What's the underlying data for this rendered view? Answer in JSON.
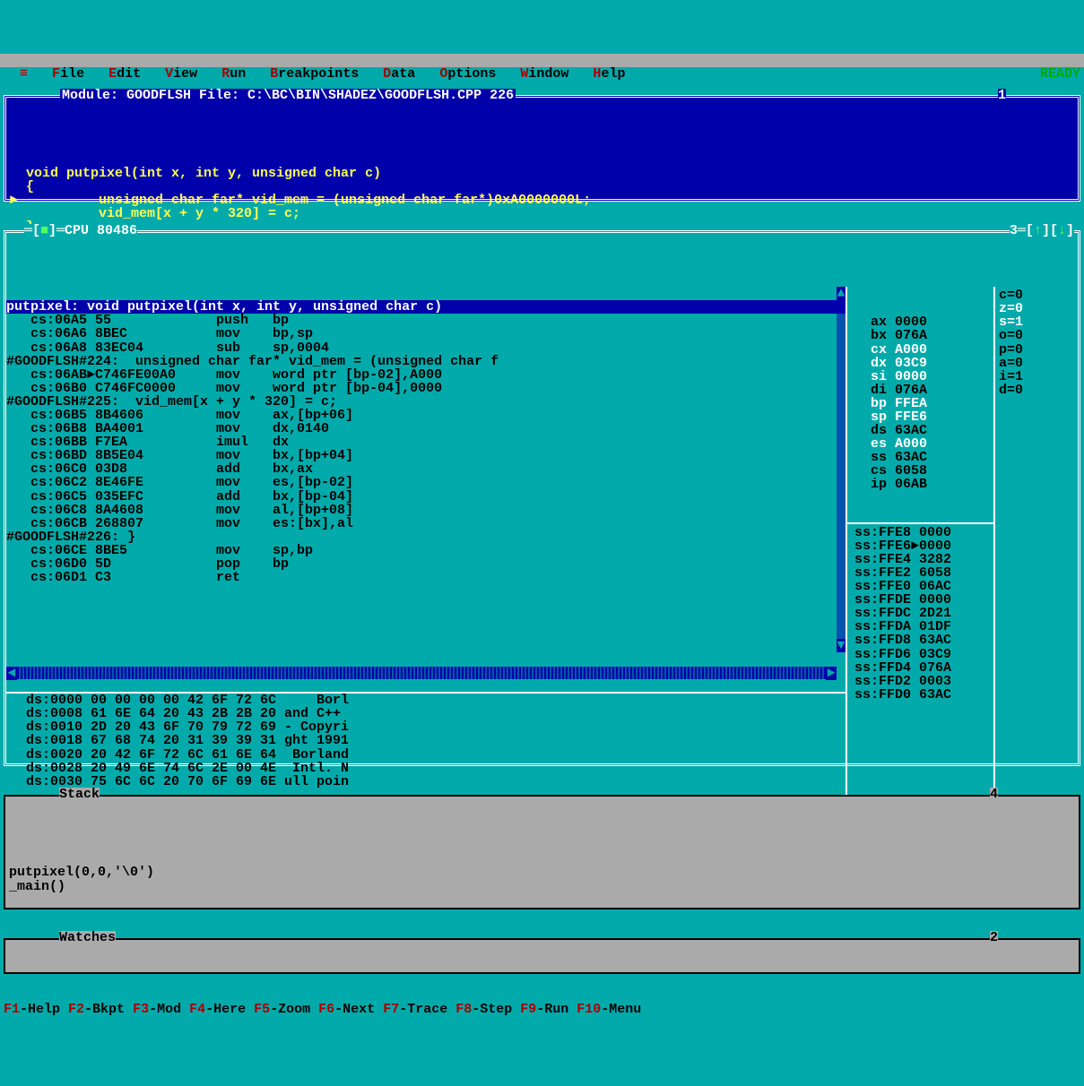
{
  "menubar": {
    "items": [
      {
        "hl": "F",
        "rest": "ile"
      },
      {
        "hl": "E",
        "rest": "dit"
      },
      {
        "hl": "V",
        "rest": "iew"
      },
      {
        "hl": "R",
        "rest": "un"
      },
      {
        "hl": "B",
        "rest": "reakpoints"
      },
      {
        "hl": "D",
        "rest": "ata"
      },
      {
        "hl": "O",
        "rest": "ptions"
      },
      {
        "hl": "W",
        "rest": "indow"
      },
      {
        "hl": "H",
        "rest": "elp"
      }
    ],
    "status": "READY",
    "sysicon": "≡"
  },
  "module": {
    "title": "Module: GOODFLSH File: C:\\BC\\BIN\\SHADEZ\\GOODFLSH.CPP 226",
    "window_num": "1",
    "lines": [
      "  void putpixel(int x, int y, unsigned char c)",
      "  {",
      "►          unsigned char far* vid_mem = (unsigned char far*)0xA0000000L;",
      "           vid_mem[x + y * 320] = c;",
      "  }"
    ]
  },
  "cpu": {
    "title": "[■]═CPU 80486",
    "window_num": "3═[↑][↓]",
    "func_sig": "putpixel: void putpixel(int x, int y, unsigned char c)",
    "disasm": [
      "   cs:06A5 55             push   bp",
      "   cs:06A6 8BEC           mov    bp,sp",
      "   cs:06A8 83EC04         sub    sp,0004",
      "#GOODFLSH#224:  unsigned char far* vid_mem = (unsigned char f",
      "   cs:06AB►C746FE00A0     mov    word ptr [bp-02],A000",
      "   cs:06B0 C746FC0000     mov    word ptr [bp-04],0000",
      "#GOODFLSH#225:  vid_mem[x + y * 320] = c;",
      "   cs:06B5 8B4606         mov    ax,[bp+06]",
      "   cs:06B8 BA4001         mov    dx,0140",
      "   cs:06BB F7EA           imul   dx",
      "   cs:06BD 8B5E04         mov    bx,[bp+04]",
      "   cs:06C0 03D8           add    bx,ax",
      "   cs:06C2 8E46FE         mov    es,[bp-02]",
      "   cs:06C5 035EFC         add    bx,[bp-04]",
      "   cs:06C8 8A4608         mov    al,[bp+08]",
      "   cs:06CB 268807         mov    es:[bx],al",
      "#GOODFLSH#226: }",
      "   cs:06CE 8BE5           mov    sp,bp",
      "   cs:06D0 5D             pop    bp",
      "   cs:06D1 C3             ret"
    ],
    "dump": [
      "  ds:0000 00 00 00 00 42 6F 72 6C     Borl",
      "  ds:0008 61 6E 64 20 43 2B 2B 20 and C++",
      "  ds:0010 2D 20 43 6F 70 79 72 69 - Copyri",
      "  ds:0018 67 68 74 20 31 39 39 31 ght 1991",
      "  ds:0020 20 42 6F 72 6C 61 6E 64  Borland",
      "  ds:0028 20 49 6E 74 6C 2E 00 4E  Intl. N",
      "  ds:0030 75 6C 6C 20 70 6F 69 6E ull poin"
    ],
    "regs": [
      {
        "name": "ax",
        "val": "0000",
        "hl": false
      },
      {
        "name": "bx",
        "val": "076A",
        "hl": false
      },
      {
        "name": "cx",
        "val": "A000",
        "hl": true
      },
      {
        "name": "dx",
        "val": "03C9",
        "hl": true
      },
      {
        "name": "si",
        "val": "0000",
        "hl": true
      },
      {
        "name": "di",
        "val": "076A",
        "hl": false
      },
      {
        "name": "bp",
        "val": "FFEA",
        "hl": true
      },
      {
        "name": "sp",
        "val": "FFE6",
        "hl": true
      },
      {
        "name": "ds",
        "val": "63AC",
        "hl": false
      },
      {
        "name": "es",
        "val": "A000",
        "hl": true
      },
      {
        "name": "ss",
        "val": "63AC",
        "hl": false
      },
      {
        "name": "cs",
        "val": "6058",
        "hl": false
      },
      {
        "name": "ip",
        "val": "06AB",
        "hl": false
      }
    ],
    "stack_mem": [
      {
        "addr": "ss:FFE8",
        "val": "0000",
        "ptr": false
      },
      {
        "addr": "ss:FFE6",
        "val": "0000",
        "ptr": true
      },
      {
        "addr": "ss:FFE4",
        "val": "3282",
        "ptr": false
      },
      {
        "addr": "ss:FFE2",
        "val": "6058",
        "ptr": false
      },
      {
        "addr": "ss:FFE0",
        "val": "06AC",
        "ptr": false
      },
      {
        "addr": "ss:FFDE",
        "val": "0000",
        "ptr": false
      },
      {
        "addr": "ss:FFDC",
        "val": "2D21",
        "ptr": false
      },
      {
        "addr": "ss:FFDA",
        "val": "01DF",
        "ptr": false
      },
      {
        "addr": "ss:FFD8",
        "val": "63AC",
        "ptr": false
      },
      {
        "addr": "ss:FFD6",
        "val": "03C9",
        "ptr": false
      },
      {
        "addr": "ss:FFD4",
        "val": "076A",
        "ptr": false
      },
      {
        "addr": "ss:FFD2",
        "val": "0003",
        "ptr": false
      },
      {
        "addr": "ss:FFD0",
        "val": "63AC",
        "ptr": false
      }
    ],
    "flags": [
      {
        "name": "c",
        "val": "0",
        "hl": false
      },
      {
        "name": "z",
        "val": "0",
        "hl": true
      },
      {
        "name": "s",
        "val": "1",
        "hl": true
      },
      {
        "name": "o",
        "val": "0",
        "hl": false
      },
      {
        "name": "p",
        "val": "0",
        "hl": false
      },
      {
        "name": "a",
        "val": "0",
        "hl": false
      },
      {
        "name": "i",
        "val": "1",
        "hl": false
      },
      {
        "name": "d",
        "val": "0",
        "hl": false
      }
    ]
  },
  "stack": {
    "title": "Stack",
    "window_num": "4",
    "lines": [
      "putpixel(0,0,'\\0')",
      "_main()"
    ]
  },
  "watches": {
    "title": "Watches",
    "window_num": "2"
  },
  "fkeys": [
    {
      "key": "F1",
      "label": "-Help"
    },
    {
      "key": "F2",
      "label": "-Bkpt"
    },
    {
      "key": "F3",
      "label": "-Mod"
    },
    {
      "key": "F4",
      "label": "-Here"
    },
    {
      "key": "F5",
      "label": "-Zoom"
    },
    {
      "key": "F6",
      "label": "-Next"
    },
    {
      "key": "F7",
      "label": "-Trace"
    },
    {
      "key": "F8",
      "label": "-Step"
    },
    {
      "key": "F9",
      "label": "-Run"
    },
    {
      "key": "F10",
      "label": "-Menu"
    }
  ]
}
